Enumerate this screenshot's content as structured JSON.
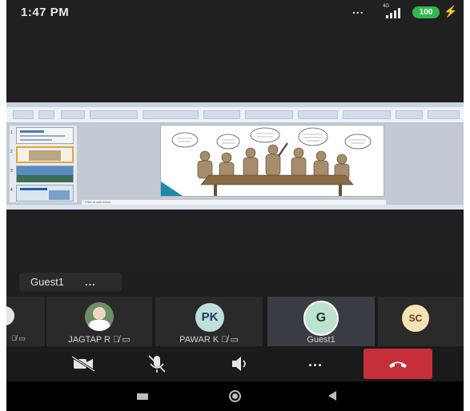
{
  "status_bar": {
    "time": "1:47 PM",
    "overflow": "...",
    "network": "4G",
    "battery": "100"
  },
  "shared_screen": {
    "app": "PowerPoint",
    "notes_placeholder": "Click to add notes"
  },
  "active_speaker": {
    "name": "Guest1",
    "more": "..."
  },
  "participants": [
    {
      "name": "JAGTAP R",
      "initials": "",
      "avatar_type": "photo"
    },
    {
      "name": "PAWAR K",
      "initials": "PK",
      "avatar_type": "initials",
      "color": "#bde0dc"
    },
    {
      "name": "Guest1",
      "initials": "G",
      "avatar_type": "initials",
      "color": "#bde2cf",
      "active": true
    },
    {
      "name": "",
      "initials": "SC",
      "avatar_type": "initials",
      "color": "#f5e2b4"
    }
  ],
  "controls": {
    "video": "video-off-icon",
    "mic": "mic-off-icon",
    "speaker": "speaker-icon",
    "more": "...",
    "end": "end-call-icon",
    "end_color": "#c62e3a"
  },
  "colors": {
    "accent_green": "#2fb84e",
    "end_call_red": "#c62e3a"
  }
}
